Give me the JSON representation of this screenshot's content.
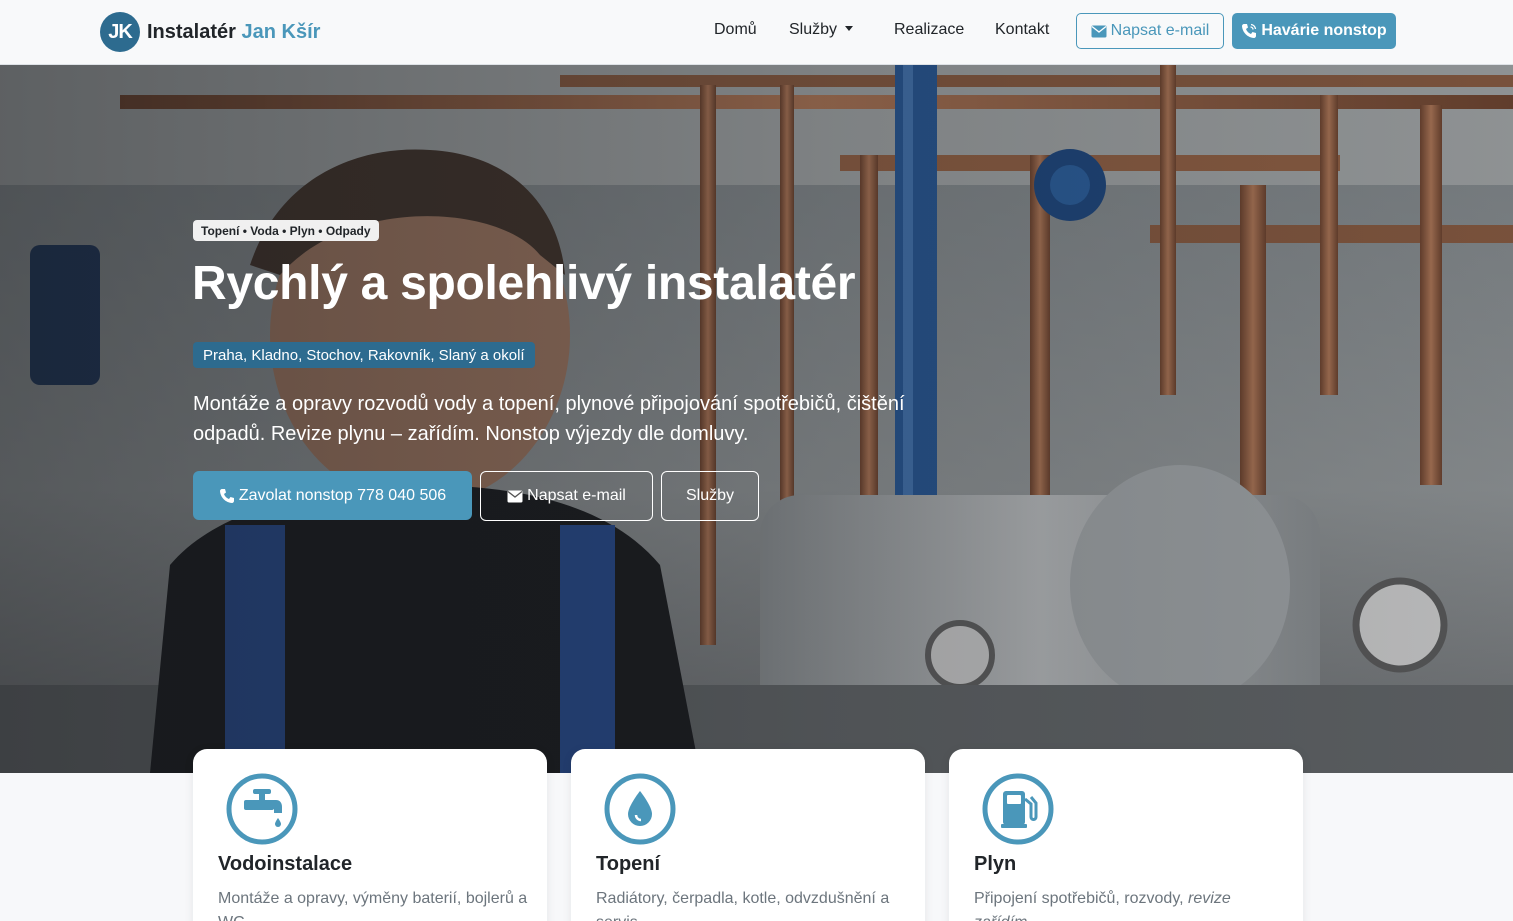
{
  "brand": {
    "logo": "JK",
    "name_first": "Instalatér",
    "name_second": "Jan Kšír"
  },
  "nav": {
    "items": [
      "Domů",
      "Služby",
      "Realizace",
      "Kontakt"
    ],
    "email_button": "Napsat e-mail",
    "emergency_button": "Havárie nonstop"
  },
  "hero": {
    "tagline": "Topení • Voda • Plyn • Odpady",
    "title": "Rychlý a spolehlivý instalatér",
    "region": "Praha, Kladno, Stochov, Rakovník, Slaný a okolí",
    "lead": "Montáže a opravy rozvodů vody a topení, plynové připojování spotřebičů, čištění odpadů. Revize plynu – zařídím. Nonstop výjezdy dle domluvy.",
    "call_button": "Zavolat nonstop 778 040 506",
    "email_button": "Napsat e-mail",
    "services_button": "Služby"
  },
  "cards": [
    {
      "icon": "faucet-icon",
      "title": "Vodoinstalace",
      "text": "Montáže a opravy, výměny baterií, bojlerů a WC."
    },
    {
      "icon": "water-drop-icon",
      "title": "Topení",
      "text": "Radiátory, čerpadla, kotle, odvzdušnění a servis."
    },
    {
      "icon": "gas-pump-icon",
      "title": "Plyn",
      "text": "Připojení spotřebičů, rozvody,",
      "text_em": "revize zařídím."
    }
  ],
  "colors": {
    "accent": "#4a97ba",
    "brand_dark": "#2d6b8f"
  }
}
